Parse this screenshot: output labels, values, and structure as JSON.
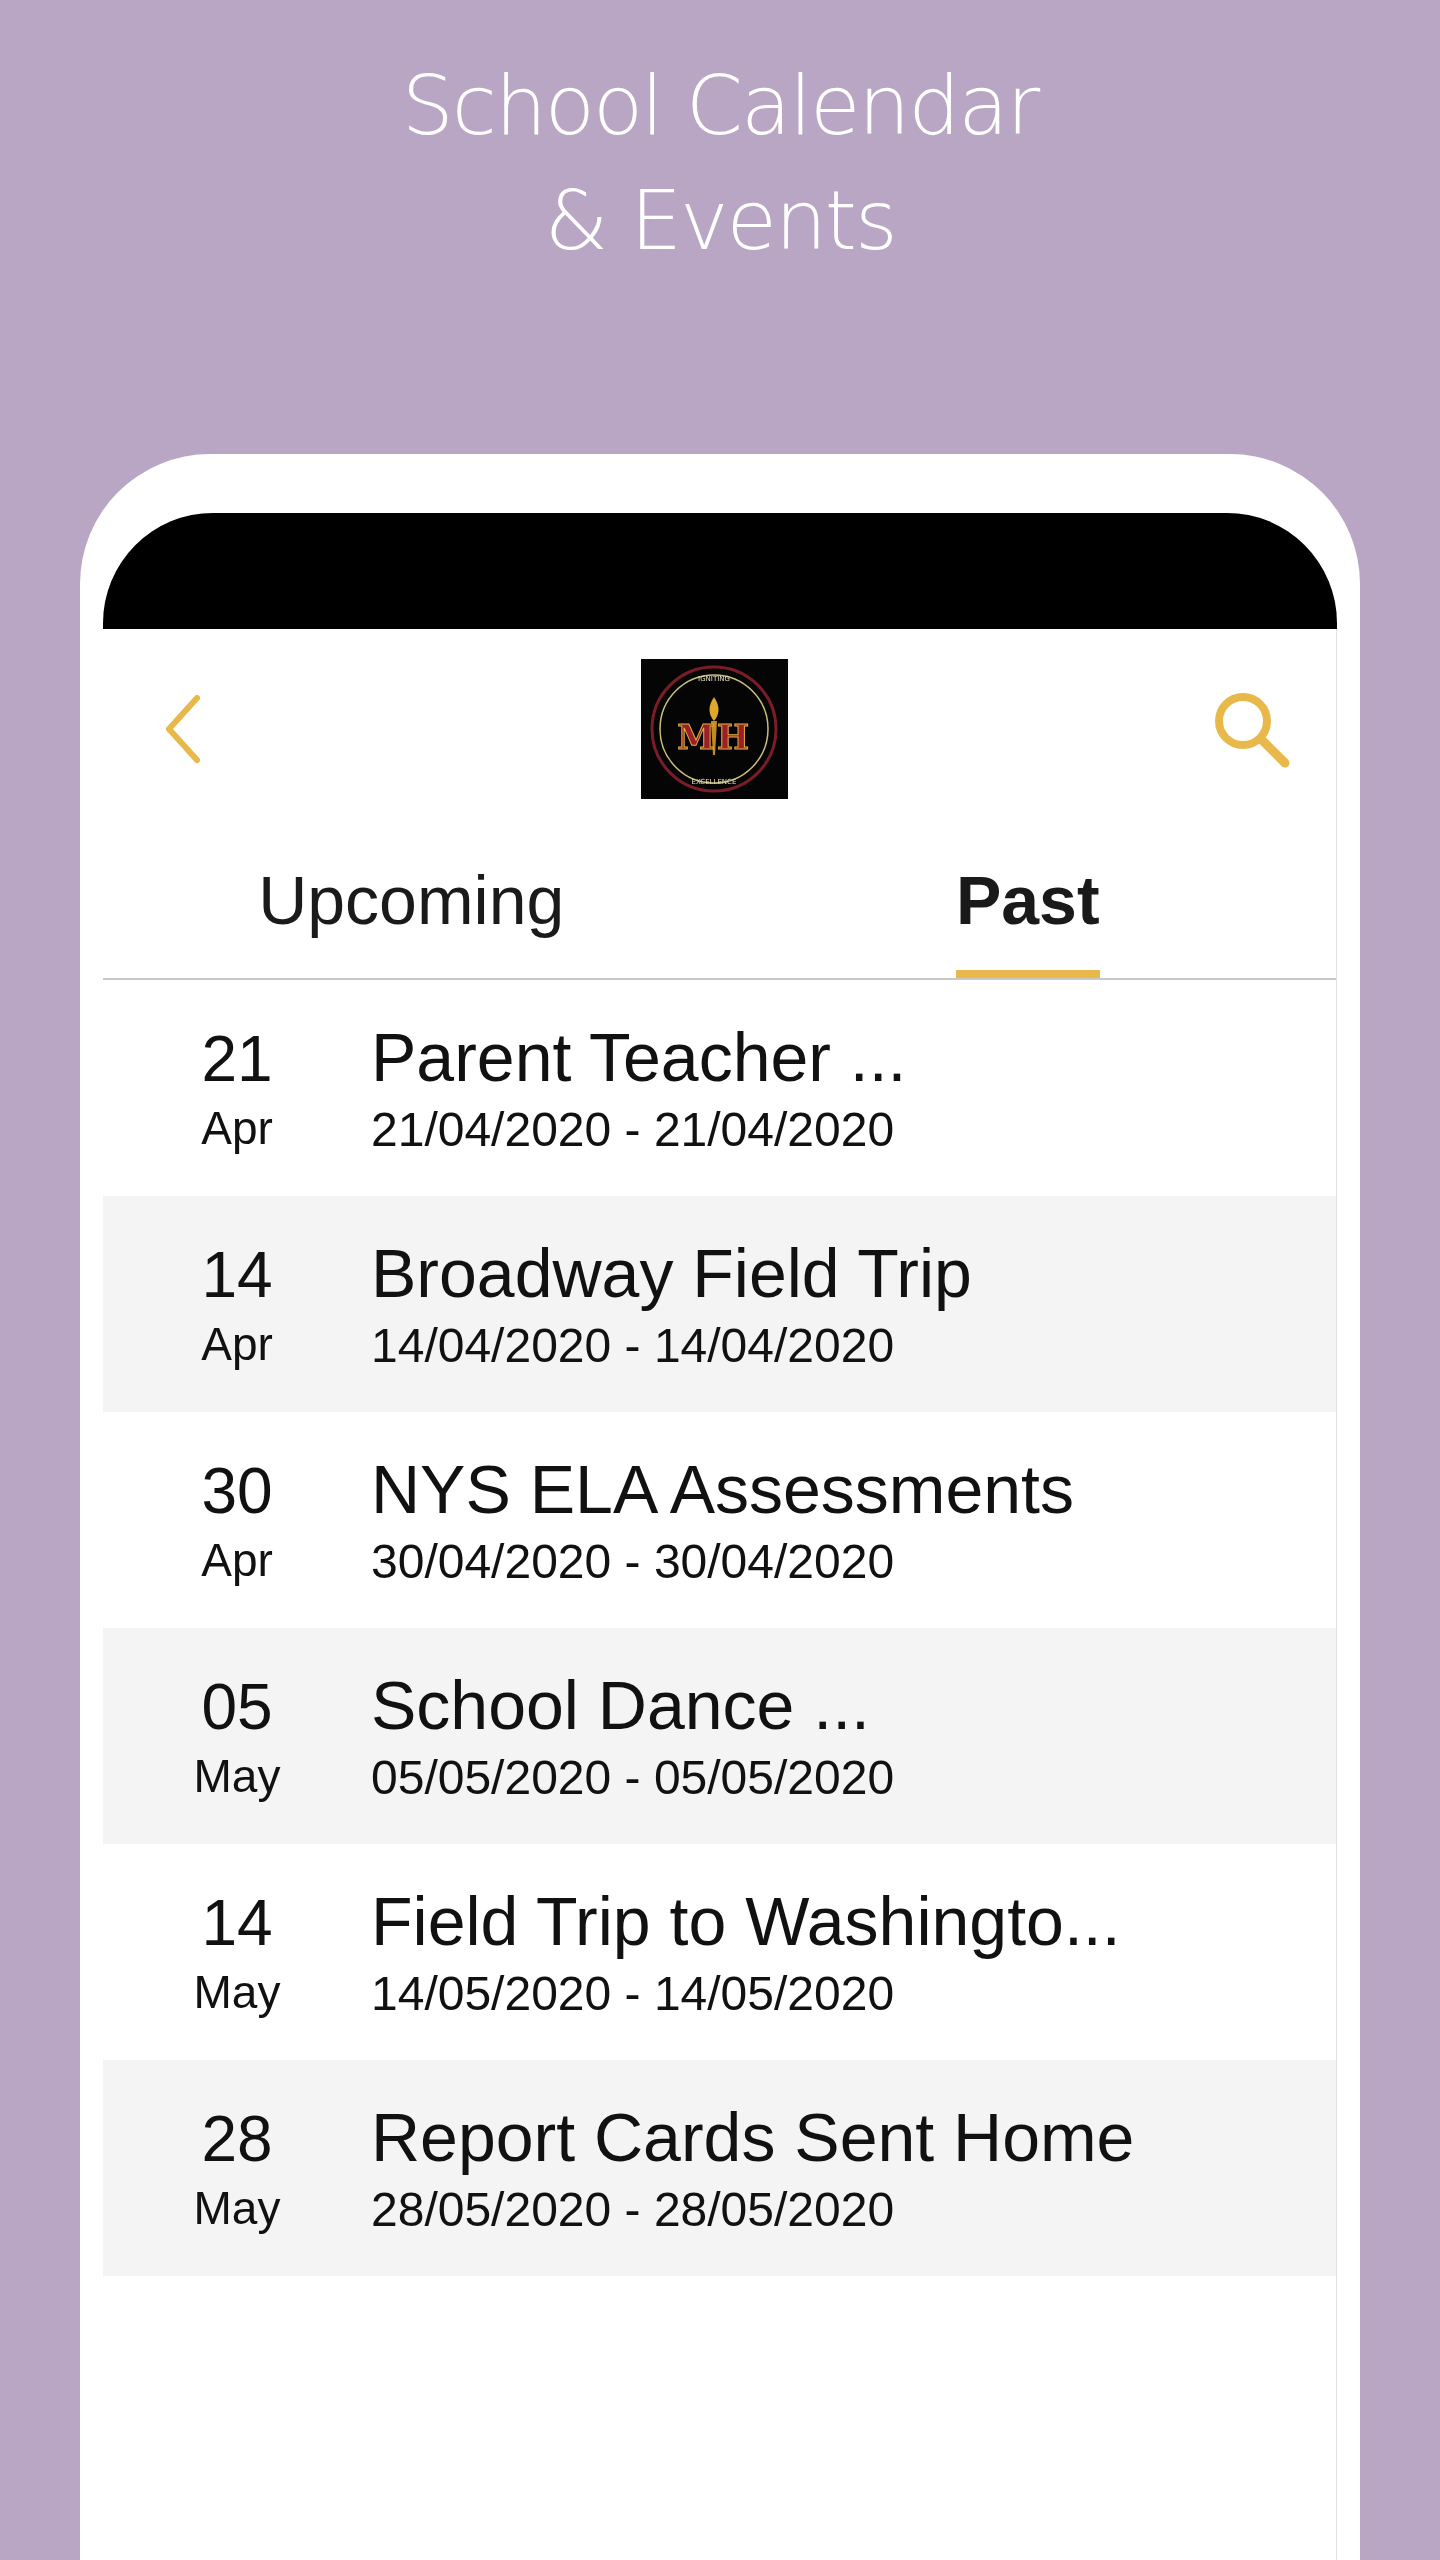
{
  "headline": [
    "School Calendar",
    "& Events"
  ],
  "logo": {
    "top_text": "IGNITING",
    "letters": [
      "M",
      "H"
    ],
    "bottom_text": "EXCELLENCE"
  },
  "tabs": [
    {
      "label": "Upcoming",
      "selected": false
    },
    {
      "label": "Past",
      "selected": true
    }
  ],
  "events": [
    {
      "day": "21",
      "month": "Apr",
      "title": "Parent Teacher ...",
      "dates": "21/04/2020 - 21/04/2020"
    },
    {
      "day": "14",
      "month": "Apr",
      "title": "Broadway Field Trip",
      "dates": "14/04/2020 - 14/04/2020"
    },
    {
      "day": "30",
      "month": "Apr",
      "title": "NYS ELA Assessments",
      "dates": "30/04/2020 - 30/04/2020"
    },
    {
      "day": "05",
      "month": "May",
      "title": "School Dance ...",
      "dates": "05/05/2020 - 05/05/2020"
    },
    {
      "day": "14",
      "month": "May",
      "title": "Field Trip to Washingto...",
      "dates": "14/05/2020 - 14/05/2020"
    },
    {
      "day": "28",
      "month": "May",
      "title": "Report Cards Sent Home",
      "dates": "28/05/2020 - 28/05/2020"
    }
  ]
}
